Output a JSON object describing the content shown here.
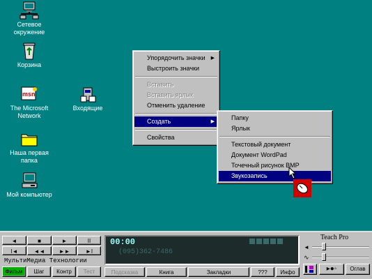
{
  "desktop": {
    "icons": [
      {
        "label": "Сетевое окружение",
        "icon": "network-neighborhood-icon"
      },
      {
        "label": "Корзина",
        "icon": "recycle-bin-icon"
      },
      {
        "label": "The Microsoft Network",
        "icon": "msn-icon"
      },
      {
        "label": "Входящие",
        "icon": "inbox-icon"
      },
      {
        "label": "Наша первая папка",
        "icon": "folder-icon"
      },
      {
        "label": "Мой компьютер",
        "icon": "my-computer-icon"
      }
    ]
  },
  "context_menu": {
    "items": [
      "Упорядочить значки",
      "Выстроить значки",
      "Вставить",
      "Вставить ярлык",
      "Отменить удаление",
      "Создать",
      "Свойства"
    ]
  },
  "submenu": {
    "items": [
      "Папку",
      "Ярлык",
      "Текстовый документ",
      "Документ WordPad",
      "Точечный рисунок BMP",
      "Звукозапись"
    ]
  },
  "player": {
    "brand": "МультиМедиа Технологии",
    "transport": [
      "◄",
      "■",
      "►",
      "II",
      "I◄",
      "◄◄",
      "►►",
      "►I"
    ],
    "tabs": [
      "Фильм",
      "Шаг",
      "Контр",
      "Тест"
    ],
    "lcd_time": "00:00",
    "lcd_phone": "(095)362-7486",
    "lcd_buttons": [
      "Подсказка",
      "Книга",
      "Закладки",
      "???",
      "Инфо"
    ],
    "teach_title": "Teach Pro",
    "exit_label": "Оглав"
  },
  "colors": {
    "desktop": "#008080",
    "highlight": "#000080",
    "lcd": "#1d2b2b"
  }
}
